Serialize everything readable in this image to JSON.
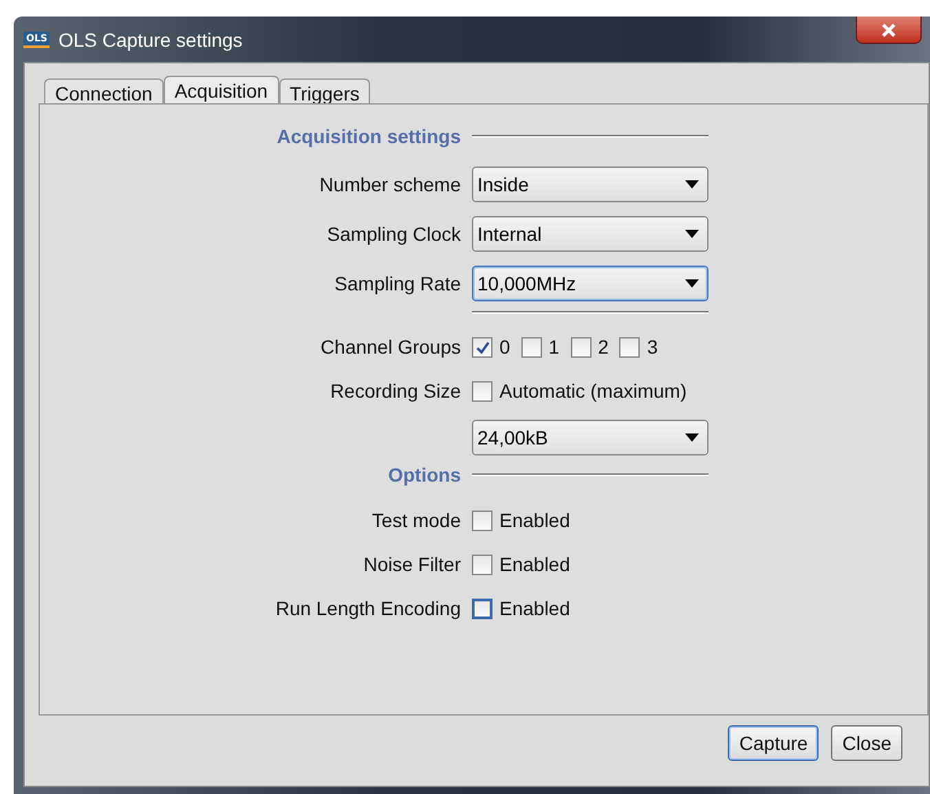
{
  "window": {
    "title": "OLS Capture settings",
    "icon_text": "OLS"
  },
  "tabs": [
    {
      "label": "Connection",
      "selected": false
    },
    {
      "label": "Acquisition",
      "selected": true
    },
    {
      "label": "Triggers",
      "selected": false
    }
  ],
  "rows": [
    {
      "kind": "header",
      "label": "Acquisition settings"
    },
    {
      "kind": "combo",
      "label": "Number scheme",
      "value": "Inside",
      "focused": false
    },
    {
      "kind": "combo",
      "label": "Sampling Clock",
      "value": "Internal",
      "focused": false
    },
    {
      "kind": "combo",
      "label": "Sampling Rate",
      "value": "10,000MHz",
      "focused": true
    },
    {
      "kind": "separator"
    },
    {
      "kind": "checks",
      "label": "Channel Groups",
      "options": [
        {
          "label": "0",
          "checked": true
        },
        {
          "label": "1",
          "checked": false
        },
        {
          "label": "2",
          "checked": false
        },
        {
          "label": "3",
          "checked": false
        }
      ]
    },
    {
      "kind": "checkbox",
      "label": "Recording Size",
      "text": "Automatic (maximum)",
      "checked": false,
      "focused": false
    },
    {
      "kind": "combo",
      "value": "24,00kB",
      "focused": false
    },
    {
      "kind": "header",
      "label": "Options"
    },
    {
      "kind": "checkbox",
      "label": "Test mode",
      "text": "Enabled",
      "checked": false,
      "focused": false
    },
    {
      "kind": "checkbox",
      "label": "Noise Filter",
      "text": "Enabled",
      "checked": false,
      "focused": false
    },
    {
      "kind": "checkbox",
      "label": "Run Length Encoding",
      "text": "Enabled",
      "checked": false,
      "focused": true
    }
  ],
  "buttons": [
    {
      "label": "Capture",
      "default": true
    },
    {
      "label": "Close",
      "default": false
    }
  ]
}
